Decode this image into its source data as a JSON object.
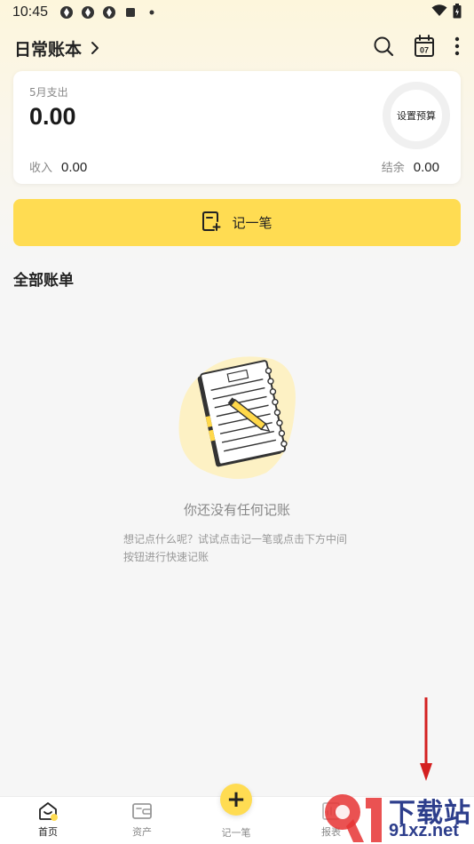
{
  "status_bar": {
    "time": "10:45"
  },
  "header": {
    "title": "日常账本"
  },
  "summary": {
    "expense_label": "5月支出",
    "expense_value": "0.00",
    "budget_label": "设置预算",
    "income_label": "收入",
    "income_value": "0.00",
    "balance_label": "结余",
    "balance_value": "0.00"
  },
  "record_button": {
    "label": "记一笔"
  },
  "bills": {
    "section_title": "全部账单",
    "empty_title": "你还没有任何记账",
    "empty_hint": "想记点什么呢？试试点击记一笔或点击下方中间按钮进行快速记账"
  },
  "tabbar": {
    "home": "首页",
    "assets": "资产",
    "record": "记一笔",
    "report": "报表"
  },
  "watermark": {
    "text_top": "下载站",
    "text_bottom": "91xz.net"
  },
  "colors": {
    "accent": "#ffdc52",
    "arrow": "#d42020",
    "watermark": "#2d3e8c"
  }
}
